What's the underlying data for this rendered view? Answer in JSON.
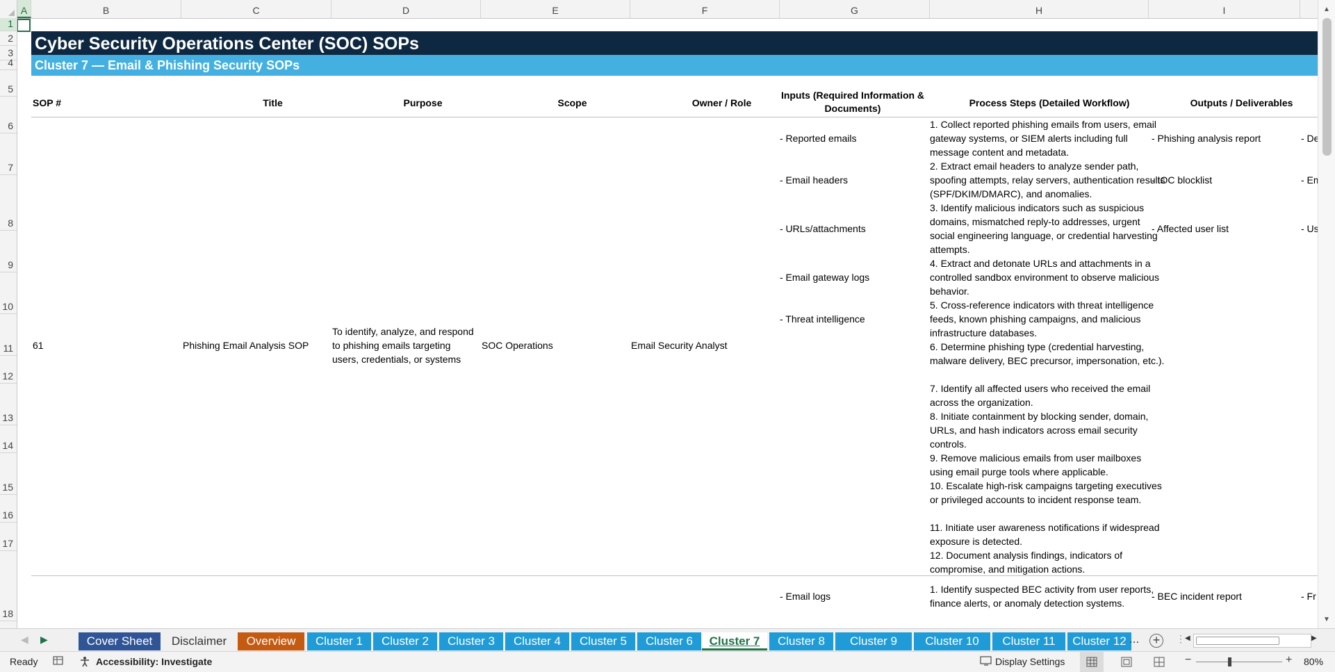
{
  "columns": [
    "A",
    "B",
    "C",
    "D",
    "E",
    "F",
    "G",
    "H",
    "I"
  ],
  "rows": [
    "1",
    "2",
    "3",
    "4",
    "5",
    "6",
    "7",
    "8",
    "9",
    "10",
    "11",
    "12",
    "13",
    "14",
    "15",
    "16",
    "17",
    "18"
  ],
  "banner": {
    "title": "Cyber Security Operations Center (SOC) SOPs",
    "subtitle": "Cluster 7 — Email & Phishing Security SOPs"
  },
  "headers": {
    "sop_no": "SOP #",
    "title": "Title",
    "purpose": "Purpose",
    "scope": "Scope",
    "owner": "Owner / Role",
    "inputs": "Inputs (Required Information & Documents)",
    "process": "Process Steps (Detailed Workflow)",
    "outputs": "Outputs / Deliverables"
  },
  "sop61": {
    "number": "61",
    "title": "Phishing Email Analysis SOP",
    "purpose": "To identify, analyze, and respond to phishing emails targeting users, credentials, or systems",
    "scope": "SOC Operations",
    "owner": "Email Security Analyst",
    "inputs": [
      "- Reported emails",
      "- Email headers",
      "- URLs/attachments",
      "- Email gateway logs",
      "- Threat intelligence"
    ],
    "steps": [
      "1. Collect reported phishing emails from users, email gateway systems, or SIEM alerts including full message content and metadata.",
      "2. Extract email headers to analyze sender path, spoofing attempts, relay servers, authentication results (SPF/DKIM/DMARC), and anomalies.",
      "3. Identify malicious indicators such as suspicious domains, mismatched reply-to addresses, urgent social engineering language, or credential harvesting attempts.",
      "4. Extract and detonate URLs and attachments in a controlled sandbox environment to observe malicious behavior.",
      "5. Cross-reference indicators with threat intelligence feeds, known phishing campaigns, and malicious infrastructure databases.",
      "6. Determine phishing type (credential harvesting, malware delivery, BEC precursor, impersonation, etc.).",
      "7. Identify all affected users who received the email across the organization.",
      "8. Initiate containment by blocking sender, domain, URLs, and hash indicators across email security controls.",
      "9. Remove malicious emails from user mailboxes using email purge tools where applicable.",
      "10. Escalate high-risk campaigns targeting executives or privileged accounts to incident response team.",
      "11. Initiate user awareness notifications if widespread exposure is detected.",
      "12. Document analysis findings, indicators of compromise, and mitigation actions."
    ],
    "outputs": [
      "- Phishing analysis report",
      "- IOC blocklist",
      "- Affected user list"
    ],
    "col_j_partial": [
      "- De",
      "- Em",
      "- Us"
    ]
  },
  "sop_next": {
    "inputs": [
      "- Email logs"
    ],
    "steps": [
      "1. Identify suspected BEC activity from user reports, finance alerts, or anomaly detection systems."
    ],
    "outputs": [
      "- BEC incident report"
    ],
    "col_j_partial": [
      "- Fr"
    ]
  },
  "tabs": [
    {
      "label": "Cover Sheet",
      "color": "#2f5597"
    },
    {
      "label": "Disclaimer",
      "color": "#f0f0f0",
      "text": "#333333"
    },
    {
      "label": "Overview",
      "color": "#c55a11"
    },
    {
      "label": "Cluster 1",
      "color": "#1f9bd7"
    },
    {
      "label": "Cluster 2",
      "color": "#1f9bd7"
    },
    {
      "label": "Cluster 3",
      "color": "#1f9bd7"
    },
    {
      "label": "Cluster 4",
      "color": "#1f9bd7"
    },
    {
      "label": "Cluster 5",
      "color": "#1f9bd7"
    },
    {
      "label": "Cluster 6",
      "color": "#1f9bd7"
    },
    {
      "label": "Cluster 7",
      "color": "#ffffff",
      "active": true
    },
    {
      "label": "Cluster 8",
      "color": "#1f9bd7"
    },
    {
      "label": "Cluster 9",
      "color": "#1f9bd7"
    },
    {
      "label": "Cluster 10",
      "color": "#1f9bd7"
    },
    {
      "label": "Cluster 11",
      "color": "#1f9bd7"
    },
    {
      "label": "Cluster 12",
      "color": "#1f9bd7"
    }
  ],
  "tabs_more": "...",
  "status": {
    "ready": "Ready",
    "accessibility": "Accessibility: Investigate",
    "display_settings": "Display Settings",
    "zoom": "80%"
  },
  "colors": {
    "banner_dark": "#0e2841",
    "banner_light": "#44b0e1",
    "excel_green": "#217346"
  }
}
